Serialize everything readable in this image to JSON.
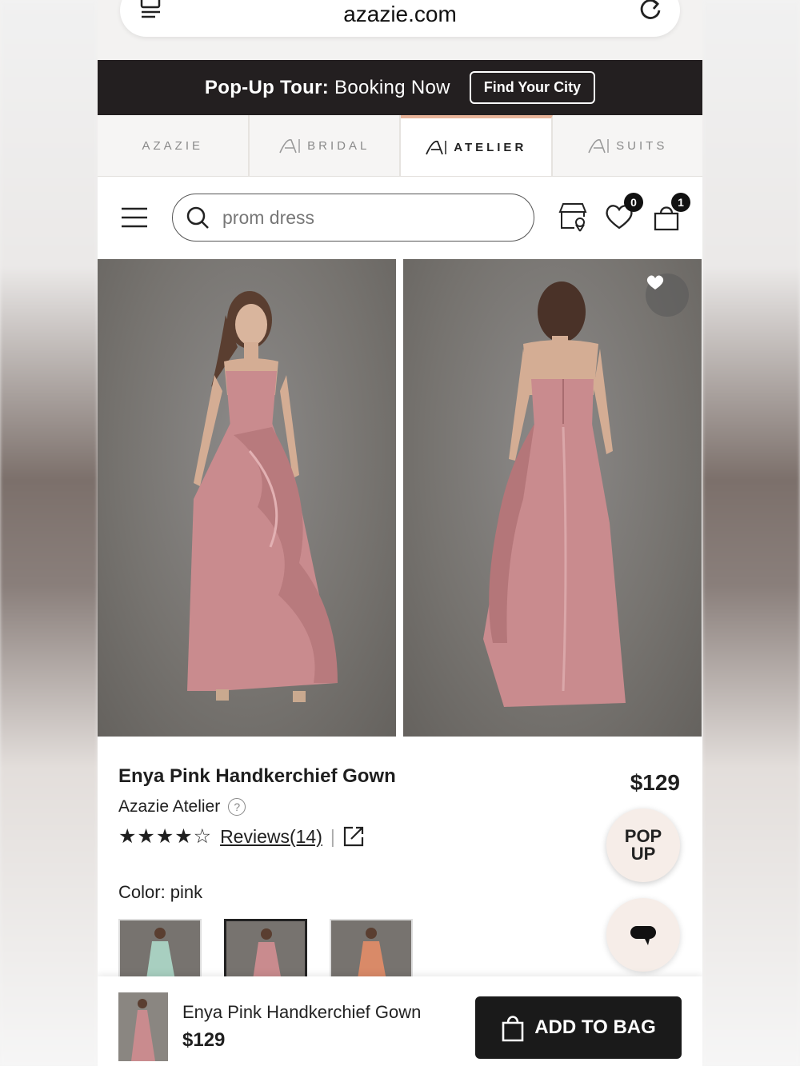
{
  "browser": {
    "url": "azazie.com",
    "icons": {
      "tabs": "tabs-icon",
      "reload": "reload-icon"
    }
  },
  "promo": {
    "bold": "Pop-Up Tour:",
    "text": " Booking Now",
    "button": "Find Your City"
  },
  "brand_tabs": [
    {
      "label": "AZAZIE",
      "active": false,
      "logo": false
    },
    {
      "label": "BRIDAL",
      "active": false,
      "logo": true
    },
    {
      "label": "ATELIER",
      "active": true,
      "logo": true
    },
    {
      "label": "SUITS",
      "active": false,
      "logo": true
    }
  ],
  "header": {
    "search_value": "prom dress",
    "wishlist_count": "0",
    "bag_count": "1"
  },
  "product": {
    "title": "Enya Pink Handkerchief Gown",
    "price": "$129",
    "brand": "Azazie Atelier",
    "help_glyph": "?",
    "stars": "★★★★☆",
    "rating": 4.5,
    "reviews": "Reviews(14)",
    "divider": "|",
    "color_label": "Color: pink",
    "swatches": [
      {
        "color": "#a8cfc0",
        "selected": false
      },
      {
        "color": "#c98b8e",
        "selected": true
      },
      {
        "color": "#d98a68",
        "selected": false
      }
    ],
    "dress_color": "#c98b8e"
  },
  "pop_up": {
    "line1": "POP",
    "line2": "UP"
  },
  "sticky": {
    "name": "Enya Pink Handkerchief Gown",
    "price": "$129",
    "button": "ADD TO BAG"
  }
}
